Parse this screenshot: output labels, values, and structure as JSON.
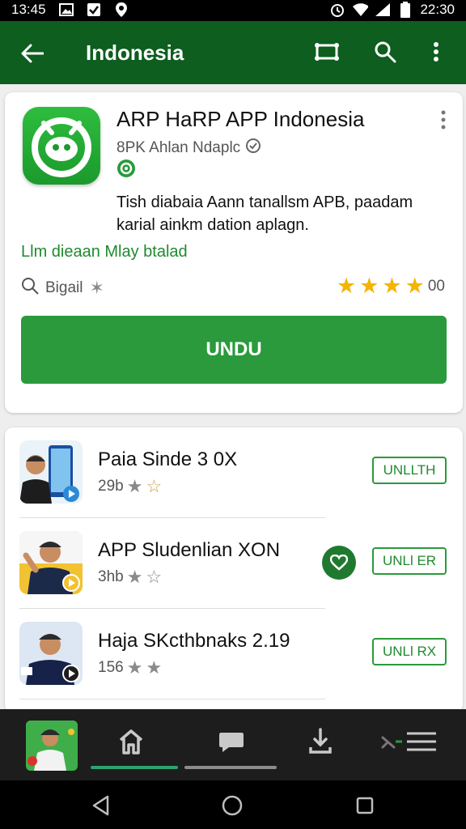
{
  "status_bar": {
    "time_left": "13:45",
    "time_right": "22:30",
    "icons": [
      "image-icon",
      "check-box-icon",
      "location-icon",
      "alarm-icon",
      "wifi-icon",
      "signal-icon",
      "battery-icon"
    ]
  },
  "app_bar": {
    "title": "Indonesia",
    "background": "#0d5e1f",
    "actions": [
      "cast-icon",
      "search-icon",
      "more-vert-icon"
    ]
  },
  "featured": {
    "name": "ARP HaRP APP Indonesia",
    "developer": "8PK Ahlan Ndaplс",
    "description": "Tish diabaia Aann tanallsm APB, paadam karial ainkm dation aplagn.",
    "link_text": "Llm dieaan Mlay btalad",
    "meta_left": "Bigail",
    "rating_stars": 4,
    "rating_count": "00",
    "install_label": "UNDU",
    "accent": "#2a9a3c"
  },
  "list": [
    {
      "title": "Paia Sinde 3 0X",
      "meta": "29b",
      "stars": 2,
      "button": "UNLLTH"
    },
    {
      "title": "APP Sludenlian XON",
      "meta": "3hb",
      "stars": 2,
      "button": "UNLl ER",
      "favorite": true
    },
    {
      "title": "Haja SKcthbnaks 2.19",
      "meta": "156",
      "stars": 2,
      "button": "UNLl RX"
    }
  ],
  "bottom_nav": {
    "icons": [
      "home-icon",
      "chat-icon",
      "download-icon",
      "menu-icon"
    ]
  },
  "system_nav": [
    "back-icon",
    "home-circle-icon",
    "recents-icon"
  ]
}
